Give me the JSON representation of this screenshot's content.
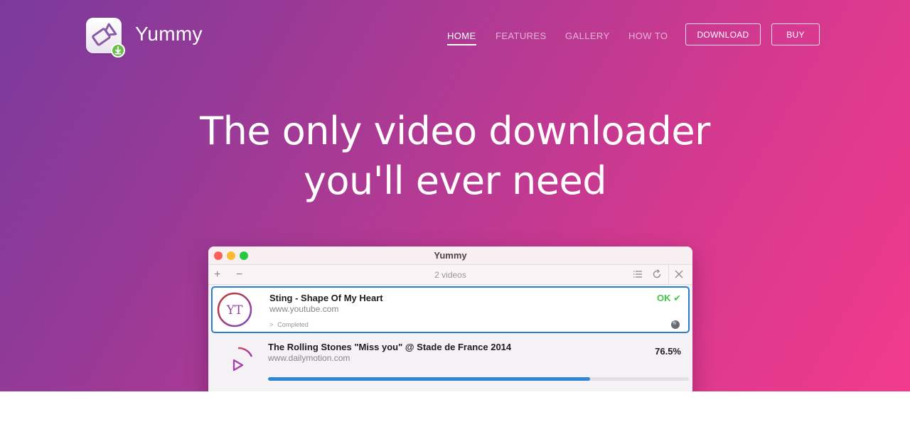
{
  "header": {
    "brand": "Yummy",
    "nav": [
      {
        "label": "HOME",
        "active": true
      },
      {
        "label": "FEATURES",
        "active": false
      },
      {
        "label": "GALLERY",
        "active": false
      },
      {
        "label": "HOW TO",
        "active": false
      }
    ],
    "download_label": "DOWNLOAD",
    "buy_label": "BUY"
  },
  "hero": {
    "line1": "The only video downloader",
    "line2": "you'll ever need"
  },
  "app_window": {
    "title": "Yummy",
    "video_count": "2 videos",
    "downloads": [
      {
        "icon": "yt-logo",
        "icon_text": "YT",
        "title": "Sting - Shape Of My Heart",
        "url": "www.youtube.com",
        "status_text": "Completed",
        "result": "OK ✔"
      },
      {
        "icon": "dailymotion-logo",
        "title": "The Rolling Stones \"Miss you\" @ Stade de France 2014",
        "url": "www.dailymotion.com",
        "progress_label": "76.5%",
        "progress": 0.765
      }
    ]
  },
  "colors": {
    "gradient_start": "#7a3a9c",
    "gradient_end": "#f23b8c",
    "selection_border": "#2b7fc8",
    "ok_green": "#3fc84a",
    "progress_blue": "#2d86d6"
  }
}
